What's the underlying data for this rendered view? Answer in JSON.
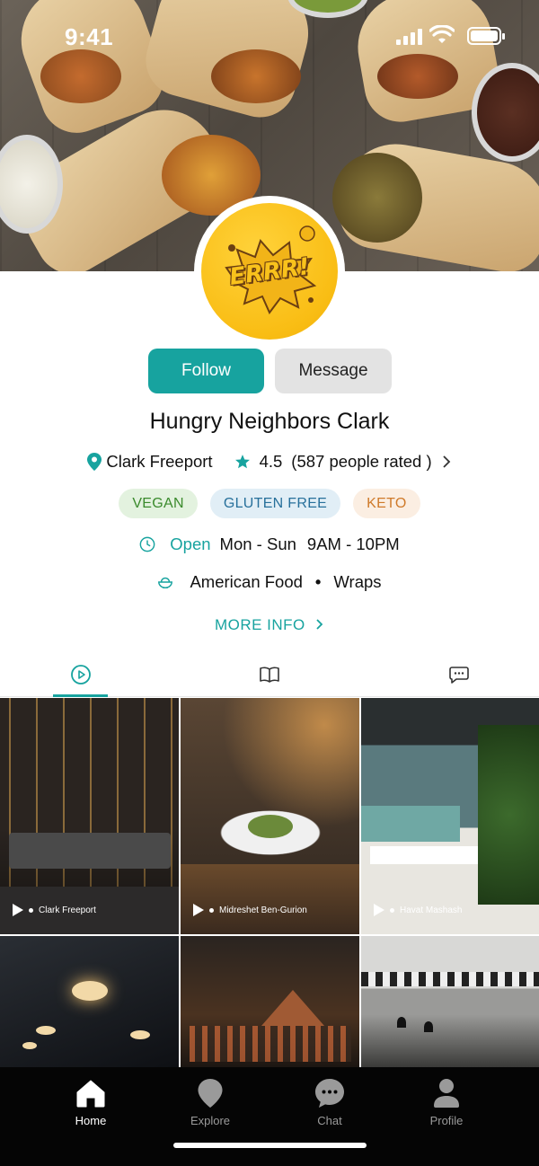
{
  "status_bar": {
    "time": "9:41"
  },
  "profile": {
    "logo_text": "ERRR!",
    "name": "Hungry Neighbors Clark",
    "location": "Clark Freeport",
    "rating": "4.5",
    "rating_count": "(587 people rated )",
    "tags": [
      "VEGAN",
      "GLUTEN FREE",
      "KETO"
    ],
    "open_status": "Open",
    "days": "Mon - Sun",
    "hours": "9AM - 10PM",
    "cuisine": [
      "American Food",
      "Wraps"
    ],
    "more_info": "MORE INFO"
  },
  "actions": {
    "follow": "Follow",
    "message": "Message"
  },
  "tabs": [
    {
      "icon": "play-circle-icon",
      "active": true
    },
    {
      "icon": "book-icon",
      "active": false
    },
    {
      "icon": "chat-bubble-icon",
      "active": false
    }
  ],
  "grid": [
    {
      "label": "Clark Freeport"
    },
    {
      "label": "Midreshet Ben-Gurion"
    },
    {
      "label": "Havat Mashash"
    },
    {
      "label": ""
    },
    {
      "label": ""
    },
    {
      "label": ""
    }
  ],
  "bottom_nav": [
    {
      "label": "Home",
      "icon": "home-icon",
      "active": true
    },
    {
      "label": "Explore",
      "icon": "map-pin-icon",
      "active": false
    },
    {
      "label": "Chat",
      "icon": "chat-icon",
      "active": false
    },
    {
      "label": "Profile",
      "icon": "user-icon",
      "active": false
    }
  ],
  "colors": {
    "accent": "#17a39f",
    "nav_bg": "#050505"
  }
}
